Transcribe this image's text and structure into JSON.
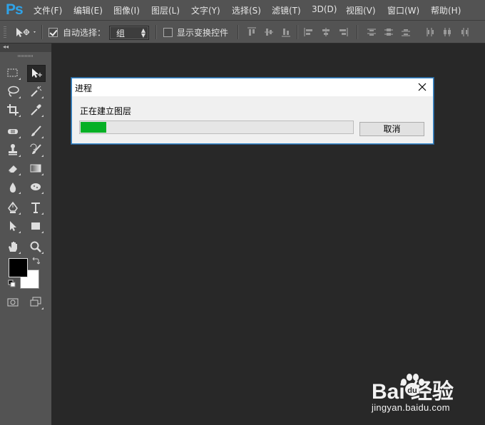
{
  "app": {
    "logo": "Ps"
  },
  "menu": [
    "文件(F)",
    "编辑(E)",
    "图像(I)",
    "图层(L)",
    "文字(Y)",
    "选择(S)",
    "滤镜(T)",
    "3D(D)",
    "视图(V)",
    "窗口(W)",
    "帮助(H)"
  ],
  "options_bar": {
    "auto_select_label": "自动选择：",
    "auto_select_checked": true,
    "auto_select_target": "组",
    "show_transform_label": "显示变换控件",
    "show_transform_checked": false
  },
  "tools": [
    "rectangular-marquee",
    "move",
    "lasso",
    "magic-wand",
    "crop",
    "eyedropper",
    "spot-healing-brush",
    "brush",
    "clone-stamp",
    "history-brush",
    "eraser",
    "gradient",
    "blur",
    "dodge",
    "pen",
    "type",
    "path-selection",
    "rectangle",
    "hand",
    "zoom"
  ],
  "colors": {
    "foreground": "#000000",
    "background": "#ffffff",
    "progress": "#06b025",
    "accent": "#2fa3e8"
  },
  "dialog": {
    "title": "进程",
    "message": "正在建立图层",
    "progress_fraction": 0.095,
    "cancel_label": "取消"
  },
  "watermark": {
    "logo_text": "Bai  经验",
    "url": "jingyan.baidu.com"
  }
}
